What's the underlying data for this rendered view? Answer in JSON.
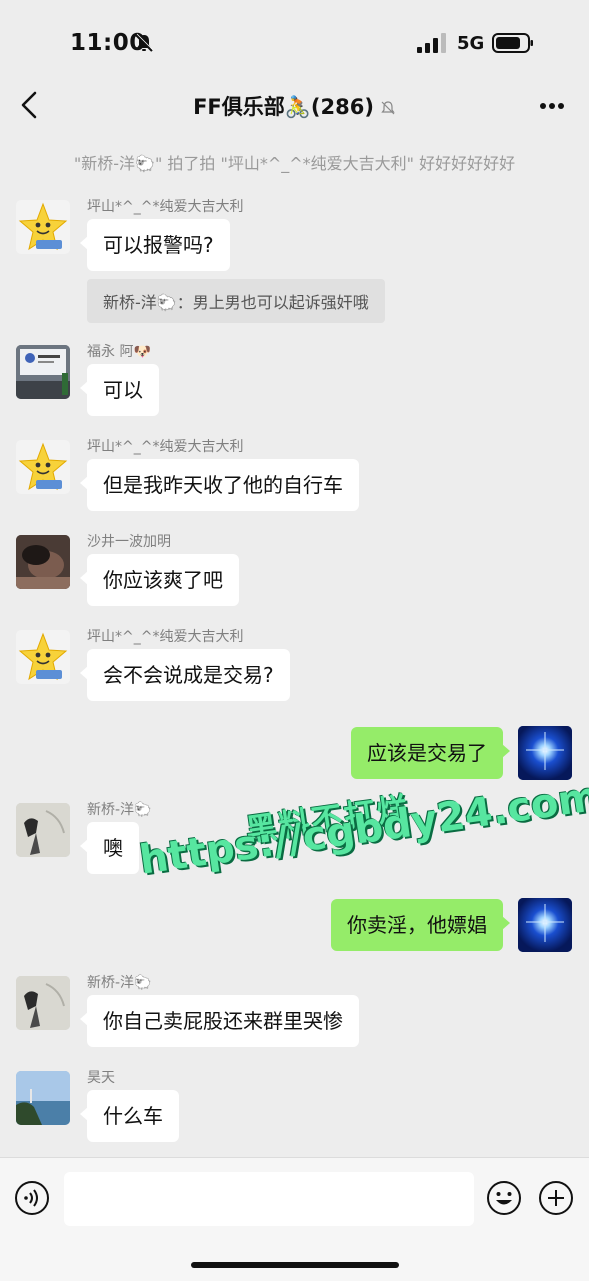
{
  "status_bar": {
    "time": "11:00",
    "network": "5G"
  },
  "nav": {
    "title": "FF俱乐部🚴(286)"
  },
  "system_message": "\"新桥-洋🐑\" 拍了拍 \"坪山*^_^*纯爱大吉大利\" 好好好好好好",
  "messages": [
    {
      "sender": "坪山*^_^*纯爱大吉大利",
      "text": "可以报警吗?",
      "quote": "新桥-洋🐑：男上男也可以起诉强奸哦"
    },
    {
      "sender": "福永 阿🐶",
      "text": "可以"
    },
    {
      "sender": "坪山*^_^*纯爱大吉大利",
      "text": "但是我昨天收了他的自行车"
    },
    {
      "sender": "沙井一波加明",
      "text": "你应该爽了吧"
    },
    {
      "sender": "坪山*^_^*纯爱大吉大利",
      "text": "会不会说成是交易?"
    },
    {
      "sender": "",
      "text": "应该是交易了"
    },
    {
      "sender": "新桥-洋🐑",
      "text": "噢"
    },
    {
      "sender": "",
      "text": "你卖淫，他嫖娼"
    },
    {
      "sender": "新桥-洋🐑",
      "text": "你自己卖屁股还来群里哭惨"
    },
    {
      "sender": "昊天",
      "text": "什么车"
    }
  ],
  "watermark": {
    "line1": "黑料不打烊",
    "line2": "https://cgbdy24.com"
  },
  "input": {
    "placeholder": ""
  },
  "colors": {
    "background": "#ededed",
    "self_bubble": "#95ec69",
    "other_bubble": "#ffffff",
    "watermark": "#57e6a0"
  }
}
